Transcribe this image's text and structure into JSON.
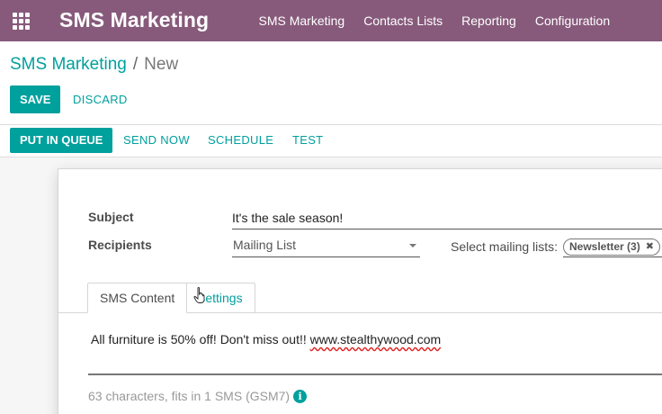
{
  "navbar": {
    "brand": "SMS Marketing",
    "menu": [
      "SMS Marketing",
      "Contacts Lists",
      "Reporting",
      "Configuration"
    ],
    "color": "#875a7b"
  },
  "breadcrumb": {
    "parent": "SMS Marketing",
    "separator": "/",
    "current": "New"
  },
  "actions": {
    "save": "SAVE",
    "discard": "DISCARD"
  },
  "statusbar": {
    "put_in_queue": "PUT IN QUEUE",
    "send_now": "SEND NOW",
    "schedule": "SCHEDULE",
    "test": "TEST"
  },
  "form": {
    "subject_label": "Subject",
    "subject_value": "It's the sale season!",
    "recipients_label": "Recipients",
    "recipients_value": "Mailing List",
    "mailing_lists_label": "Select mailing lists:",
    "mailing_list_tag": "Newsletter (3)"
  },
  "tabs": {
    "sms_content": "SMS Content",
    "settings": "Settings"
  },
  "sms": {
    "body_text": "All furniture is 50% off! Don't miss out!! ",
    "body_link": "www.stealthywood.com",
    "counter": "63 characters, fits in 1 SMS (GSM7)"
  },
  "colors": {
    "accent": "#00a09d",
    "navbar": "#875a7b"
  },
  "icons": {
    "apps": "apps-grid-icon",
    "dropdown": "chevron-down-icon",
    "remove_tag": "close-icon",
    "info": "info-icon"
  }
}
